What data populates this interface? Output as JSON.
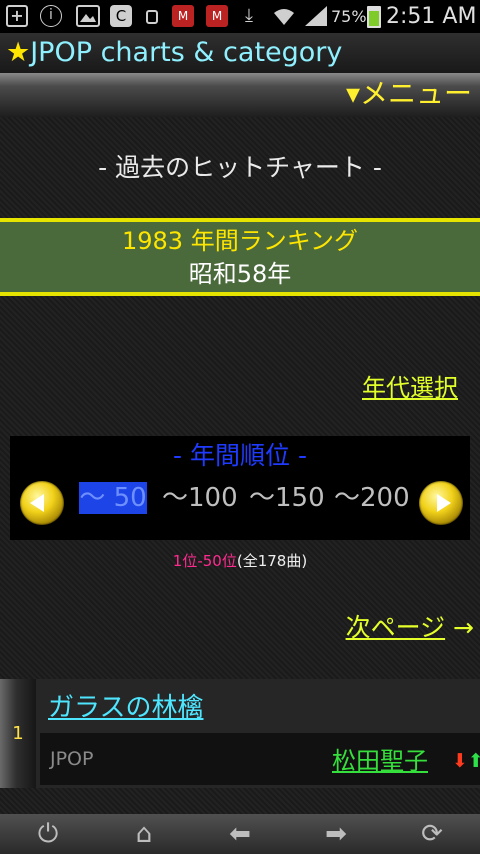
{
  "status_bar": {
    "battery_text": "75%",
    "clock": "2:51 AM",
    "icons": [
      "plus-icon",
      "info-icon",
      "image-icon",
      "clock-app-icon",
      "sd-icon",
      "mcafee-icon",
      "mcafee-icon",
      "download-icon",
      "wifi-icon",
      "signal-icon",
      "battery-icon"
    ]
  },
  "header": {
    "star": "★",
    "title": "JPOP charts & category",
    "menu_label": "▾メニュー"
  },
  "section_heading": "-  過去のヒットチャート  -",
  "year_banner": {
    "line1": "1983 年間ランキング",
    "line2": "昭和58年"
  },
  "decade_select": "年代選択",
  "rank_nav": {
    "title": "-  年間順位  -",
    "ranges": [
      "～ 50",
      "～100",
      "～150",
      "～200"
    ],
    "selected_index": 0
  },
  "range_info": {
    "range": "1位-50位",
    "total": "(全178曲)"
  },
  "next_page": {
    "label": "次ページ",
    "arrow": " →"
  },
  "songs": [
    {
      "rank": "1",
      "title": "ガラスの林檎",
      "genre": "JPOP",
      "artist": "松田聖子",
      "trend_down": "⬇",
      "trend_up": "⬆"
    }
  ],
  "toolbar": {
    "icons": [
      "power-icon",
      "home-icon",
      "back-arrow-icon",
      "forward-arrow-icon",
      "refresh-icon"
    ],
    "glyphs": [
      "⏻",
      "⌂",
      "⬅",
      "➡",
      "⟳"
    ]
  },
  "colors": {
    "title_cyan": "#8ff0ff",
    "accent_yellow": "#e4ff2a",
    "banner_green": "#4a6a3c",
    "nav_blue": "#1e3bff",
    "link_cyan": "#4ee6ff",
    "artist_green": "#36e03c"
  }
}
